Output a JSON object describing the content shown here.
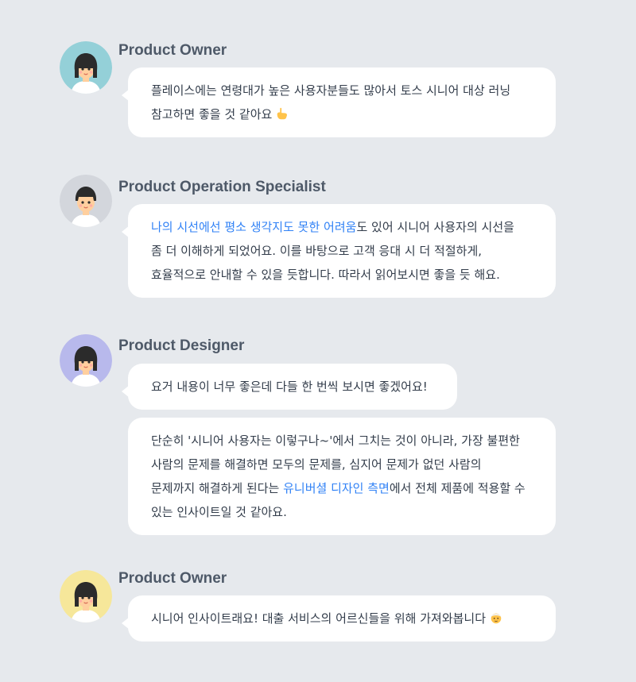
{
  "colors": {
    "background": "#e6e9ed",
    "bubble": "#ffffff",
    "highlight": "#3182f6",
    "name": "#4e5968",
    "text": "#333d4b"
  },
  "messages": [
    {
      "avatar": {
        "icon": "person-avatar-female",
        "bg": "#94d0d8"
      },
      "name": "Product Owner",
      "bubbles": [
        {
          "lines": [
            [
              {
                "text": "플레이스에는 연령대가 높은 사용자분들도 많아서 토스 시니어 대상 러닝"
              }
            ],
            [
              {
                "text": "참고하면 좋을 것 같아요"
              },
              {
                "emoji": "pointing-hand-emoji"
              }
            ]
          ]
        }
      ]
    },
    {
      "avatar": {
        "icon": "person-avatar-male",
        "bg": "#d3d6dc"
      },
      "name": "Product Operation Specialist",
      "bubbles": [
        {
          "lines": [
            [
              {
                "text": "나의 시선에선 평소 생각지도 못한 어려움",
                "hl": true
              },
              {
                "text": "도 있어 시니어 사용자의 시선을"
              }
            ],
            [
              {
                "text": "좀 더 이해하게 되었어요. 이를 바탕으로 고객 응대 시 더 적절하게,"
              }
            ],
            [
              {
                "text": "효율적으로 안내할 수 있을 듯합니다. 따라서 읽어보시면 좋을 듯 해요."
              }
            ]
          ]
        }
      ]
    },
    {
      "avatar": {
        "icon": "person-avatar-female",
        "bg": "#b8b9ec"
      },
      "name": "Product Designer",
      "bubbles": [
        {
          "lines": [
            [
              {
                "text": "요거 내용이 너무 좋은데 다들 한 번씩 보시면 좋겠어요!"
              }
            ]
          ]
        },
        {
          "lines": [
            [
              {
                "text": "단순히 '시니어 사용자는 이렇구나~'에서 그치는 것이 아니라, 가장 불편한"
              }
            ],
            [
              {
                "text": "사람의 문제를 해결하면 모두의 문제를, 심지어 문제가 없던 사람의"
              }
            ],
            [
              {
                "text": "문제까지 해결하게 된다는 "
              },
              {
                "text": "유니버셜 디자인 측면",
                "hl": true
              },
              {
                "text": "에서 전체 제품에 적용할 수"
              }
            ],
            [
              {
                "text": "있는 인사이트일 것 같아요."
              }
            ]
          ]
        }
      ]
    },
    {
      "avatar": {
        "icon": "person-avatar-female",
        "bg": "#f6e79a"
      },
      "name": "Product Owner",
      "bubbles": [
        {
          "lines": [
            [
              {
                "text": "시니어 인사이트래요! 대출 서비스의 어르신들을 위해 가져와봅니다"
              },
              {
                "emoji": "old-person-emoji"
              }
            ]
          ]
        }
      ]
    }
  ]
}
